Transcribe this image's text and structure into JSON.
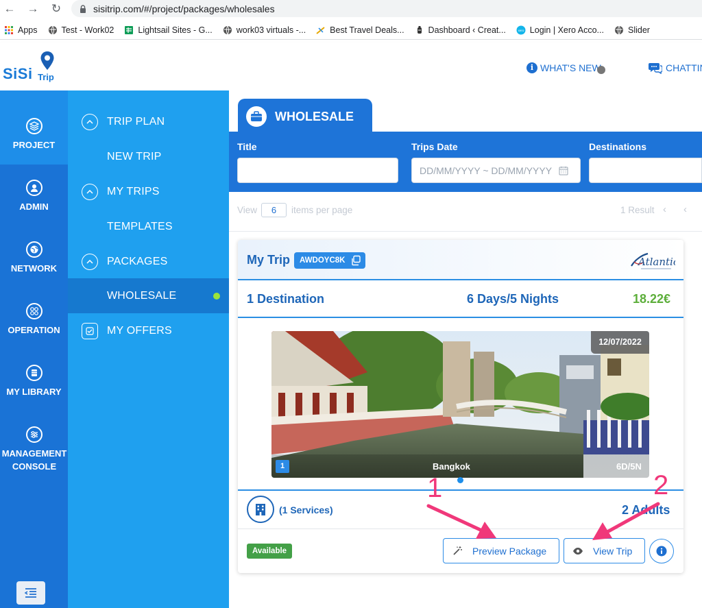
{
  "browser": {
    "url": "sisitrip.com/#/project/packages/wholesales",
    "bookmarks": [
      {
        "label": "Apps",
        "icon": "apps-grid-icon"
      },
      {
        "label": "Test - Work02",
        "icon": "globe-icon"
      },
      {
        "label": "Lightsail Sites - G...",
        "icon": "sheets-icon"
      },
      {
        "label": "work03 virtuals -...",
        "icon": "globe-icon"
      },
      {
        "label": "Best Travel Deals...",
        "icon": "travel-icon"
      },
      {
        "label": "Dashboard ‹ Creat...",
        "icon": "lantern-icon"
      },
      {
        "label": "Login | Xero Acco...",
        "icon": "xero-icon"
      },
      {
        "label": "Slider",
        "icon": "globe-icon"
      }
    ]
  },
  "header": {
    "logo_text": "SiSi",
    "logo_sub": "Trip",
    "whats_new": "WHAT'S NEW",
    "chatting": "CHATTIN"
  },
  "iconbar": {
    "items": [
      {
        "label": "PROJECT",
        "icon": "layers-icon",
        "active": true
      },
      {
        "label": "ADMIN",
        "icon": "user-icon",
        "active": false
      },
      {
        "label": "NETWORK",
        "icon": "globe-icon",
        "active": false
      },
      {
        "label": "OPERATION",
        "icon": "grid-icon",
        "active": false
      },
      {
        "label": "MY LIBRARY",
        "icon": "library-icon",
        "active": false
      },
      {
        "label": "MANAGEMENT CONSOLE",
        "icon": "sliders-icon",
        "active": false
      }
    ]
  },
  "subnav": {
    "items": [
      {
        "label": "TRIP PLAN",
        "chevron": true
      },
      {
        "label": "NEW TRIP",
        "chevron": false
      },
      {
        "label": "MY TRIPS",
        "chevron": true
      },
      {
        "label": "TEMPLATES",
        "chevron": false
      },
      {
        "label": "PACKAGES",
        "chevron": true
      },
      {
        "label": "WHOLESALE",
        "chevron": false,
        "active": true
      },
      {
        "label": "MY OFFERS",
        "chevron": false,
        "icon": "offers-icon"
      }
    ]
  },
  "main": {
    "tab_title": "WHOLESALE",
    "filters": {
      "title_label": "Title",
      "title_value": "",
      "date_label": "Trips Date",
      "date_placeholder": "DD/MM/YYYY ~ DD/MM/YYYY",
      "dest_label": "Destinations",
      "dest_value": ""
    },
    "pager": {
      "view": "View",
      "per_page": "6",
      "items_per_page": "items per page",
      "result": "1 Result"
    }
  },
  "card": {
    "title": "My Trip",
    "code": "AWDOYC8K",
    "partner_logo": "Atlantic",
    "destinations": "1 Destination",
    "duration": "6 Days/5 Nights",
    "price": "18.22€",
    "photo": {
      "date": "12/07/2022",
      "index": "1",
      "city": "Bangkok",
      "duration": "6D/5N"
    },
    "services": "(1 Services)",
    "adults": "2 Adults",
    "status": "Available",
    "preview_button": "Preview Package",
    "view_button": "View Trip"
  },
  "annotations": {
    "one": "1",
    "two": "2"
  },
  "colors": {
    "primary": "#1e74d8",
    "subnav": "#1fa0ef",
    "price_green": "#5cae3a",
    "annotation_pink": "#f0387a"
  }
}
